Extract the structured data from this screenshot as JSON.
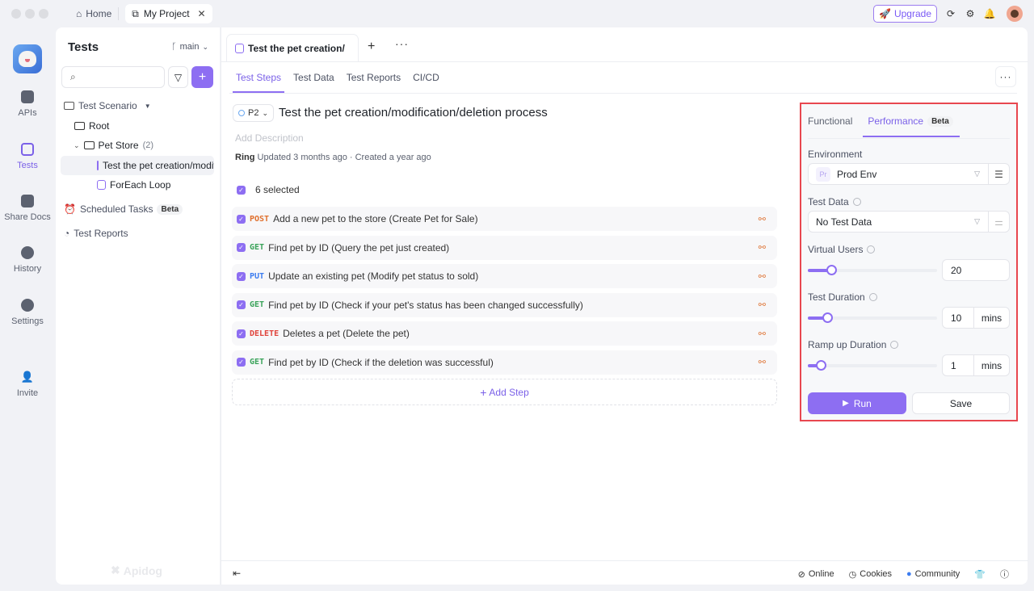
{
  "titlebar": {
    "home_label": "Home",
    "project_tab_label": "My Project",
    "upgrade_label": "Upgrade"
  },
  "rail": {
    "items": [
      {
        "label": "APIs",
        "icon": "apis-icon"
      },
      {
        "label": "Tests",
        "icon": "tests-icon",
        "active": true
      },
      {
        "label": "Share Docs",
        "icon": "book-icon"
      },
      {
        "label": "History",
        "icon": "clock-icon"
      },
      {
        "label": "Settings",
        "icon": "gear-icon"
      },
      {
        "label": "Invite",
        "icon": "add-user-icon"
      }
    ]
  },
  "left_panel": {
    "title": "Tests",
    "branch": "main",
    "search_placeholder": "",
    "tree": {
      "scenario_label": "Test Scenario",
      "root_label": "Root",
      "folder_label": "Pet Store",
      "folder_count": "(2)",
      "items": [
        "Test the pet creation/modification/deletion process",
        "ForEach Loop"
      ],
      "scheduled_label": "Scheduled Tasks",
      "scheduled_badge": "Beta",
      "reports_label": "Test Reports"
    },
    "brand": "Apidog"
  },
  "main": {
    "doc_tab_label": "Test the pet creation/",
    "subtabs": [
      "Test Steps",
      "Test Data",
      "Test Reports",
      "CI/CD"
    ],
    "priority": "P2",
    "title": "Test the pet creation/modification/deletion process",
    "description_placeholder": "Add Description",
    "meta_author": "Ring",
    "meta_text": "Updated 3 months ago · Created a year ago",
    "selected_label": "6 selected",
    "steps": [
      {
        "method": "POST",
        "color": "#e0702d",
        "text": "Add a new pet to the store (Create Pet for Sale)"
      },
      {
        "method": "GET",
        "color": "#3aa35a",
        "text": "Find pet by ID (Query the pet just created)"
      },
      {
        "method": "PUT",
        "color": "#3d7df0",
        "text": "Update an existing pet (Modify pet status to sold)"
      },
      {
        "method": "GET",
        "color": "#3aa35a",
        "text": "Find pet by ID (Check if your pet's status has been changed successfully)"
      },
      {
        "method": "DELETE",
        "color": "#e0443c",
        "text": "Deletes a pet (Delete the pet)"
      },
      {
        "method": "GET",
        "color": "#3aa35a",
        "text": "Find pet by ID (Check if the deletion was successful)"
      }
    ],
    "add_step_label": "Add Step"
  },
  "performance": {
    "tab_functional": "Functional",
    "tab_performance": "Performance",
    "tab_badge": "Beta",
    "environment_label": "Environment",
    "environment_badge": "Pr",
    "environment_value": "Prod Env",
    "test_data_label": "Test Data",
    "test_data_value": "No Test Data",
    "virtual_users_label": "Virtual Users",
    "virtual_users_value": "20",
    "virtual_users_fraction": 0.18,
    "test_duration_label": "Test Duration",
    "test_duration_value": "10",
    "test_duration_unit": "mins",
    "test_duration_fraction": 0.15,
    "ramp_label": "Ramp up Duration",
    "ramp_value": "1",
    "ramp_unit": "mins",
    "ramp_fraction": 0.1,
    "run_label": "Run",
    "save_label": "Save"
  },
  "footer": {
    "online": "Online",
    "cookies": "Cookies",
    "community": "Community"
  },
  "colors": {
    "accent": "#8d6ef2",
    "highlight_border": "#e8474f"
  }
}
